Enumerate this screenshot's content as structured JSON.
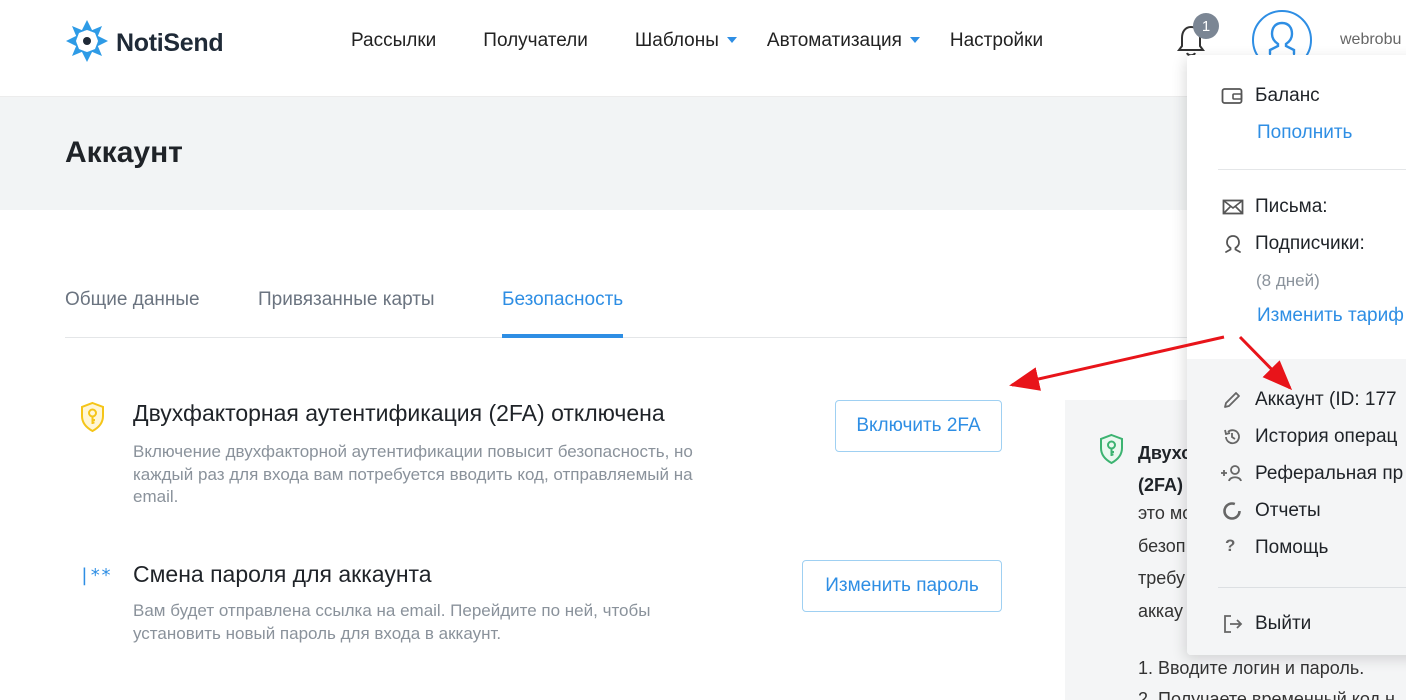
{
  "app": {
    "logo_text": "NotiSend",
    "notification_count": "1",
    "username": "webrobu"
  },
  "nav": {
    "items": [
      {
        "label": "Рассылки",
        "dropdown": false
      },
      {
        "label": "Получатели",
        "dropdown": false
      },
      {
        "label": "Шаблоны",
        "dropdown": true
      },
      {
        "label": "Автоматизация",
        "dropdown": true
      },
      {
        "label": "Настройки",
        "dropdown": false
      }
    ]
  },
  "page": {
    "title": "Аккаунт"
  },
  "tabs": [
    {
      "label": "Общие данные",
      "active": false
    },
    {
      "label": "Привязанные карты",
      "active": false
    },
    {
      "label": "Безопасность",
      "active": true
    }
  ],
  "security": {
    "twofa": {
      "title": "Двухфакторная аутентификация (2FA) отключена",
      "description": "Включение двухфакторной аутентификации повысит безопасность, но каждый раз для входа вам потребуется вводить код, отправляемый на email.",
      "button": "Включить 2FA",
      "icon": "shield-key-icon",
      "icon_color": "#f5c518"
    },
    "password": {
      "title": "Смена пароля для аккаунта",
      "description": "Вам будет отправлена ссылка на email. Перейдите по ней, чтобы установить новый пароль для входа в аккаунт.",
      "button": "Изменить пароль",
      "icon_text": "|**"
    }
  },
  "info_box": {
    "title": "Двухф (2FA)",
    "title_line1": "Двухс",
    "title_line2": "(2FA)",
    "text_lines": [
      "это мо",
      "безоп",
      "требу",
      "аккау"
    ],
    "list_lines": [
      "1. Вводите логин и пароль.",
      "2. Получаете временный код н"
    ],
    "icon_color": "#3cb371"
  },
  "dropdown": {
    "balance_label": "Баланс",
    "topup_link": "Пополнить",
    "letters_label": "Письма:",
    "subscribers_label": "Подписчики:",
    "days_note": "(8 дней)",
    "change_plan_link": "Изменить тариф",
    "menu": [
      {
        "label": "Аккаунт (ID: 177",
        "icon": "pencil-icon"
      },
      {
        "label": "История операц",
        "icon": "history-icon"
      },
      {
        "label": "Реферальная пр",
        "icon": "add-user-icon"
      },
      {
        "label": "Отчеты",
        "icon": "reports-icon"
      },
      {
        "label": "Помощь",
        "icon": "help-icon"
      }
    ],
    "logout_label": "Выйти"
  },
  "colors": {
    "accent": "#2e8ee4",
    "annotation_arrow": "#e8141a"
  }
}
